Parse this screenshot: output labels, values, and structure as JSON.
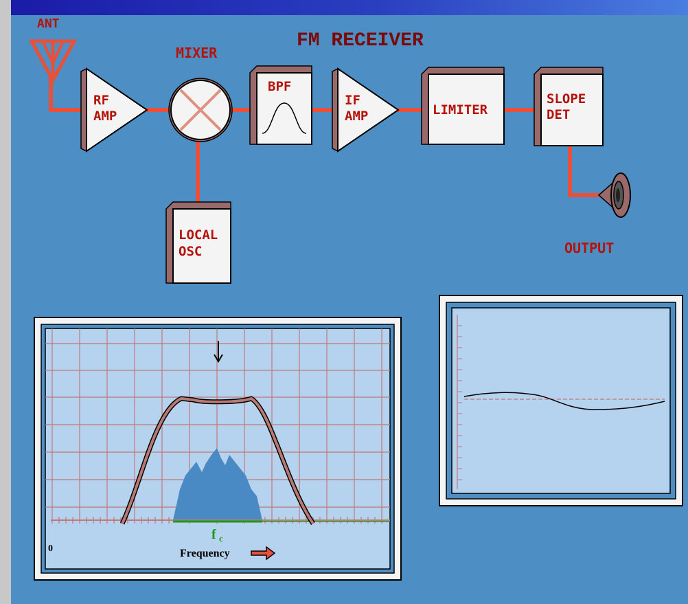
{
  "title": "FM RECEIVER",
  "blocks": {
    "antenna": "ANT",
    "rf_amp": [
      "RF",
      "AMP"
    ],
    "mixer": "MIXER",
    "bpf": "BPF",
    "if_amp": [
      "IF",
      "AMP"
    ],
    "limiter": "LIMITER",
    "slope_det": [
      "SLOPE",
      "DET"
    ],
    "local_osc": [
      "LOCAL",
      "OSC"
    ],
    "output": "OUTPUT"
  },
  "spectrum_panel": {
    "origin_label": "0",
    "fc_label": "f",
    "fc_sub": "c",
    "xlabel": "Frequency"
  },
  "colors": {
    "background": "#4d8ec4",
    "plot_bg": "#b5d3ef",
    "grid": "#c07878",
    "wire": "#e8503a",
    "label": "#b5130a",
    "spectrum": "#4a8ac4",
    "fc": "#1a9a1a"
  }
}
